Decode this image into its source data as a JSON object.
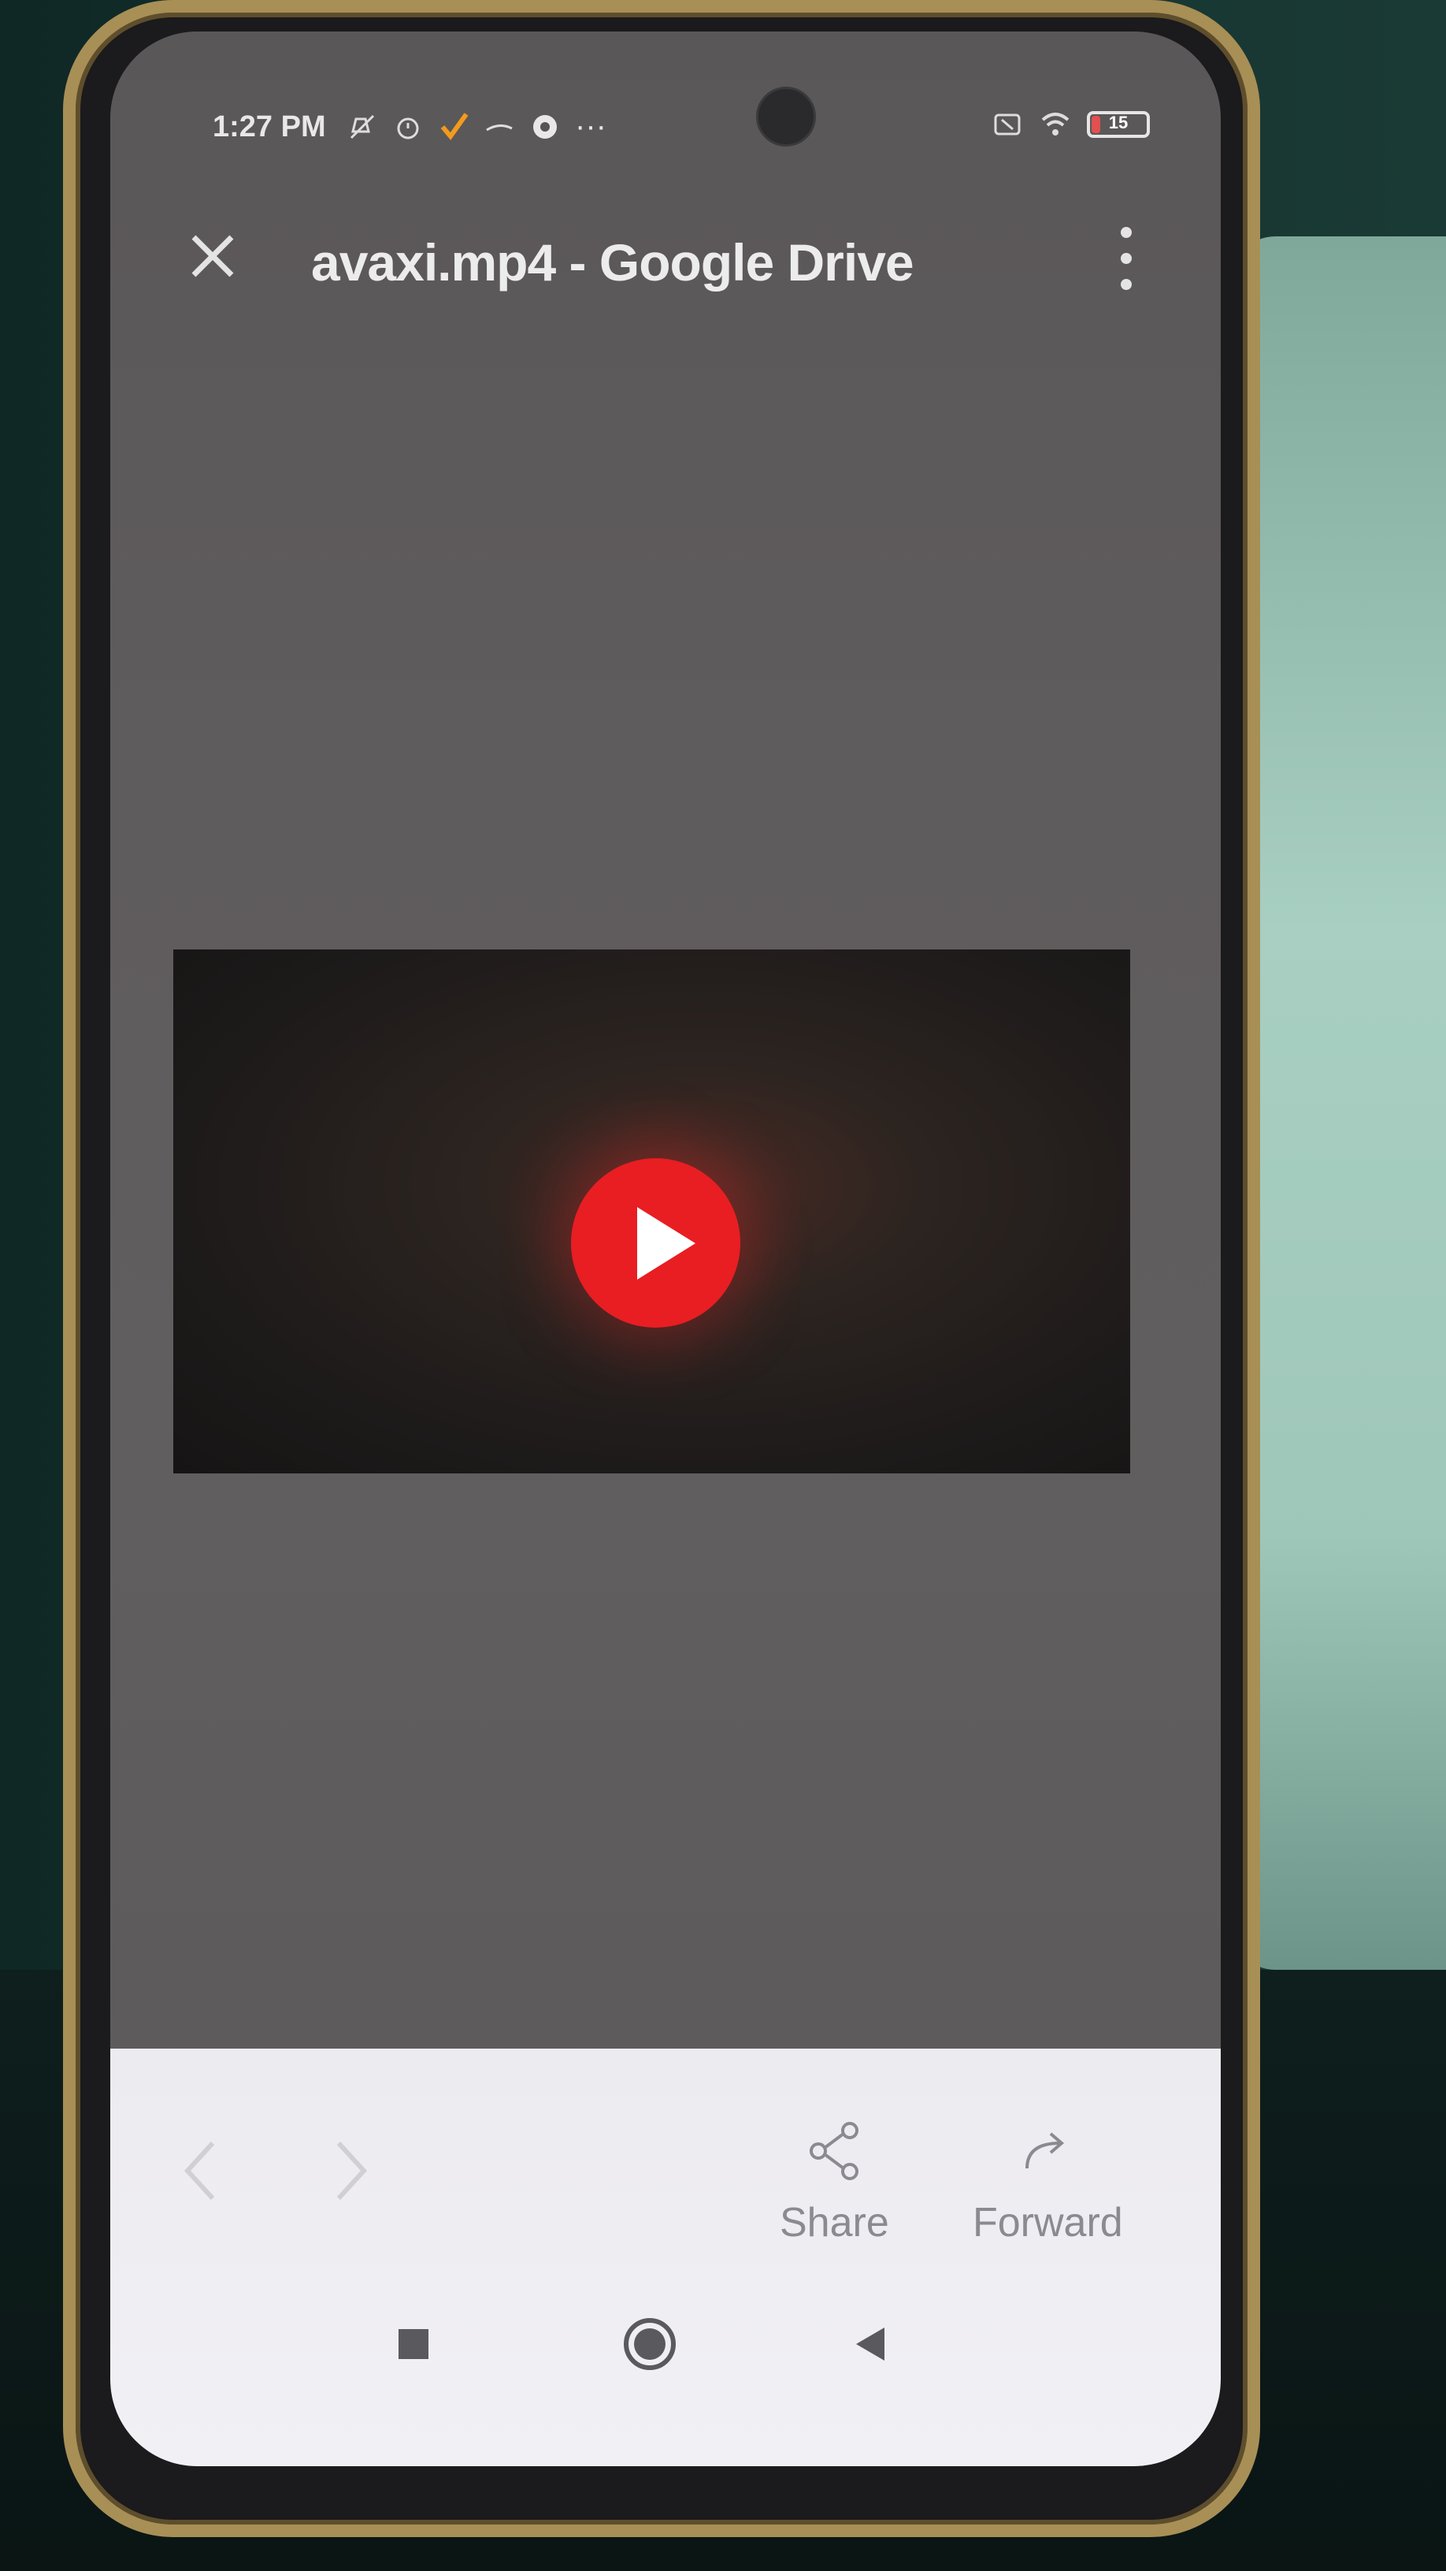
{
  "status_bar": {
    "time": "1:27 PM",
    "battery_level": "15",
    "icons": [
      "mute-icon",
      "alarm-icon",
      "check-app-icon",
      "arrow-app-icon",
      "circle-app-icon",
      "more-dots-icon",
      "battery-saver-icon",
      "wifi-icon",
      "battery-icon"
    ],
    "overflow": "···"
  },
  "toolbar": {
    "title": "avaxi.mp4 - Google Drive",
    "close_icon": "close-icon",
    "more_icon": "more-vert-icon"
  },
  "video": {
    "play_icon": "play-icon",
    "accent_color": "#e81e22"
  },
  "bottom_bar": {
    "back_icon": "chevron-left-icon",
    "forward_nav_icon": "chevron-right-icon",
    "share_label": "Share",
    "forward_label": "Forward"
  },
  "system_nav": {
    "recents_icon": "square-icon",
    "home_icon": "circle-icon",
    "back_icon": "triangle-back-icon"
  }
}
